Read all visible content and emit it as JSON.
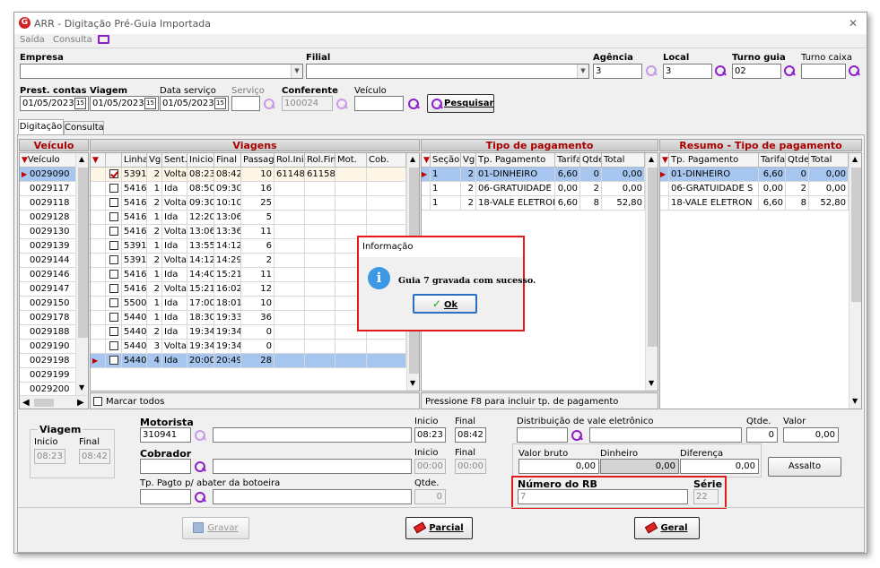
{
  "window": {
    "title": "ARR - Digitação Pré-Guia Importada",
    "close": "✕"
  },
  "menu": {
    "saida": "Saída",
    "consulta": "Consulta"
  },
  "filters": {
    "empresa_label": "Empresa",
    "filial_label": "Filial",
    "agencia_label": "Agência",
    "agencia_value": "3",
    "local_label": "Local",
    "local_value": "3",
    "turno_guia_label": "Turno guia",
    "turno_guia_value": "02",
    "turno_caixa_label": "Turno caixa",
    "prest_contas_label": "Prest. contas",
    "prest_contas_value": "01/05/2023",
    "viagem_label": "Viagem",
    "viagem_value": "01/05/2023",
    "data_servico_label": "Data serviço",
    "data_servico_value": "01/05/2023",
    "servico_label": "Serviço",
    "conferente_label": "Conferente",
    "conferente_value": "100024",
    "veiculo_label": "Veículo",
    "pesquisar": "Pesquisar"
  },
  "tabs": [
    "Digitação",
    "Consulta"
  ],
  "veiculo_panel": {
    "title": "Veículo",
    "header": "Veículo",
    "rows": [
      "0029090",
      "0029117",
      "0029118",
      "0029128",
      "0029130",
      "0029139",
      "0029144",
      "0029146",
      "0029147",
      "0029150",
      "0029178",
      "0029188",
      "0029190",
      "0029198",
      "0029199",
      "0029200"
    ]
  },
  "viagens_panel": {
    "title": "Viagens",
    "headers": [
      "Linha",
      "Vg.",
      "Sent.",
      "Inicio",
      "Final",
      "Passag.",
      "Rol.Ini",
      "Rol.Fim",
      "Mot.",
      "Cob."
    ],
    "rows": [
      {
        "checked": true,
        "linha": "5391",
        "vg": "2",
        "sent": "Volta",
        "inicio": "08:23",
        "final": "08:42",
        "passag": "10",
        "rolini": "61148",
        "rolfim": "61158"
      },
      {
        "checked": false,
        "linha": "5416",
        "vg": "1",
        "sent": "Ida",
        "inicio": "08:50",
        "final": "09:30",
        "passag": "16",
        "rolini": "",
        "rolfim": ""
      },
      {
        "checked": false,
        "linha": "5416",
        "vg": "2",
        "sent": "Volta",
        "inicio": "09:30",
        "final": "10:10",
        "passag": "25",
        "rolini": "",
        "rolfim": ""
      },
      {
        "checked": false,
        "linha": "5416",
        "vg": "1",
        "sent": "Ida",
        "inicio": "12:20",
        "final": "13:06",
        "passag": "5",
        "rolini": "",
        "rolfim": ""
      },
      {
        "checked": false,
        "linha": "5416",
        "vg": "2",
        "sent": "Volta",
        "inicio": "13:06",
        "final": "13:36",
        "passag": "11",
        "rolini": "",
        "rolfim": ""
      },
      {
        "checked": false,
        "linha": "5391",
        "vg": "1",
        "sent": "Ida",
        "inicio": "13:55",
        "final": "14:12",
        "passag": "6",
        "rolini": "",
        "rolfim": ""
      },
      {
        "checked": false,
        "linha": "5391",
        "vg": "2",
        "sent": "Volta",
        "inicio": "14:12",
        "final": "14:29",
        "passag": "2",
        "rolini": "",
        "rolfim": ""
      },
      {
        "checked": false,
        "linha": "5416",
        "vg": "1",
        "sent": "Ida",
        "inicio": "14:40",
        "final": "15:21",
        "passag": "11",
        "rolini": "",
        "rolfim": ""
      },
      {
        "checked": false,
        "linha": "5416",
        "vg": "2",
        "sent": "Volta",
        "inicio": "15:21",
        "final": "16:02",
        "passag": "12",
        "rolini": "",
        "rolfim": ""
      },
      {
        "checked": false,
        "linha": "5500",
        "vg": "1",
        "sent": "Ida",
        "inicio": "17:00",
        "final": "18:01",
        "passag": "10",
        "rolini": "",
        "rolfim": ""
      },
      {
        "checked": false,
        "linha": "5440",
        "vg": "1",
        "sent": "Ida",
        "inicio": "18:30",
        "final": "19:33",
        "passag": "36",
        "rolini": "",
        "rolfim": ""
      },
      {
        "checked": false,
        "linha": "5440",
        "vg": "2",
        "sent": "Ida",
        "inicio": "19:34",
        "final": "19:34",
        "passag": "0",
        "rolini": "",
        "rolfim": ""
      },
      {
        "checked": false,
        "linha": "5440",
        "vg": "3",
        "sent": "Volta",
        "inicio": "19:34",
        "final": "19:34",
        "passag": "0",
        "rolini": "",
        "rolfim": ""
      },
      {
        "checked": false,
        "linha": "5440",
        "vg": "4",
        "sent": "Ida",
        "inicio": "20:00",
        "final": "20:49",
        "passag": "28",
        "rolini": "",
        "rolfim": ""
      }
    ],
    "marcar_todos": "Marcar todos"
  },
  "tipo_pagamento": {
    "title": "Tipo de pagamento",
    "headers": [
      "Seção",
      "Vg.",
      "Tp. Pagamento",
      "Tarifa",
      "Qtde.",
      "Total"
    ],
    "rows": [
      {
        "secao": "1",
        "vg": "2",
        "tp": "01-DINHEIRO",
        "tarifa": "6,60",
        "qtde": "0",
        "total": "0,00"
      },
      {
        "secao": "1",
        "vg": "2",
        "tp": "06-GRATUIDADE S",
        "tarifa": "0,00",
        "qtde": "2",
        "total": "0,00"
      },
      {
        "secao": "1",
        "vg": "2",
        "tp": "18-VALE ELETRON",
        "tarifa": "6,60",
        "qtde": "8",
        "total": "52,80"
      }
    ],
    "hint": "Pressione F8 para incluir tp. de pagamento"
  },
  "resumo": {
    "title": "Resumo - Tipo de pagamento",
    "headers": [
      "Tp. Pagamento",
      "Tarifa",
      "Qtde.",
      "Total"
    ],
    "rows": [
      {
        "tp": "01-DINHEIRO",
        "tarifa": "6,60",
        "qtde": "0",
        "total": "0,00"
      },
      {
        "tp": "06-GRATUIDADE S",
        "tarifa": "0,00",
        "qtde": "2",
        "total": "0,00"
      },
      {
        "tp": "18-VALE ELETRON",
        "tarifa": "6,60",
        "qtde": "8",
        "total": "52,80"
      }
    ]
  },
  "dialog": {
    "title": "Informação",
    "message": "Guia 7 gravada com sucesso.",
    "ok": "Ok"
  },
  "bottom": {
    "viagem_group": "Viagem",
    "inicio_label": "Inicio",
    "final_label": "Final",
    "viagem_inicio": "08:23",
    "viagem_final": "08:42",
    "motorista_label": "Motorista",
    "motorista_value": "310941",
    "mot_inicio_label": "Inicio",
    "mot_final_label": "Final",
    "mot_inicio": "08:23",
    "mot_final": "08:42",
    "cobrador_label": "Cobrador",
    "cob_inicio_label": "Inicio",
    "cob_final_label": "Final",
    "cob_inicio": "00:00",
    "cob_final": "00:00",
    "tp_pagto_label": "Tp. Pagto p/ abater da botoeira",
    "tp_qtde_label": "Qtde.",
    "tp_qtde_value": "0",
    "dist_label": "Distribuição de vale eletrônico",
    "dist_qtde_label": "Qtde.",
    "dist_qtde_value": "0",
    "dist_valor_label": "Valor",
    "dist_valor_value": "0,00",
    "valor_bruto_label": "Valor bruto",
    "valor_bruto_value": "0,00",
    "dinheiro_label": "Dinheiro",
    "dinheiro_value": "0,00",
    "diferenca_label": "Diferença",
    "diferenca_value": "0,00",
    "assalto": "Assalto",
    "numero_rb_label": "Número do RB",
    "numero_rb_value": "7",
    "serie_label": "Série",
    "serie_value": "22"
  },
  "actions": {
    "gravar": "Gravar",
    "parcial": "Parcial",
    "geral": "Geral"
  }
}
